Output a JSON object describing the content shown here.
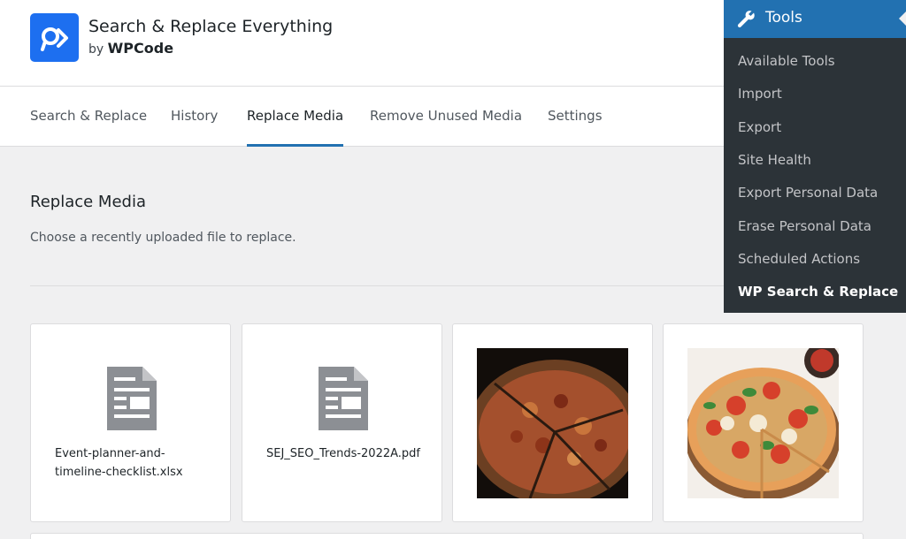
{
  "brand": {
    "title": "Search & Replace Everything",
    "by": "by",
    "by_brand": "WPCode",
    "accent": "#1d6ff0"
  },
  "tabs": [
    {
      "label": "Search & Replace",
      "active": false
    },
    {
      "label": "History",
      "active": false
    },
    {
      "label": "Replace Media",
      "active": true
    },
    {
      "label": "Remove Unused Media",
      "active": false
    },
    {
      "label": "Settings",
      "active": false
    }
  ],
  "section": {
    "title": "Replace Media",
    "description": "Choose a recently uploaded file to replace."
  },
  "media": [
    {
      "type": "document",
      "icon": "document-icon",
      "filename": "Event-planner-and-timeline-checklist.xlsx"
    },
    {
      "type": "document",
      "icon": "document-icon",
      "filename": "SEJ_SEO_Trends-2022A.pdf"
    },
    {
      "type": "image",
      "subject": "pizza-dark"
    },
    {
      "type": "image",
      "subject": "pizza-margherita"
    }
  ],
  "admin_menu": {
    "header": "Tools",
    "header_icon": "wrench-icon",
    "items": [
      {
        "label": "Available Tools",
        "current": false
      },
      {
        "label": "Import",
        "current": false
      },
      {
        "label": "Export",
        "current": false
      },
      {
        "label": "Site Health",
        "current": false
      },
      {
        "label": "Export Personal Data",
        "current": false
      },
      {
        "label": "Erase Personal Data",
        "current": false
      },
      {
        "label": "Scheduled Actions",
        "current": false
      },
      {
        "label": "WP Search & Replace",
        "current": true
      }
    ],
    "colors": {
      "background": "#2c3338",
      "header": "#2271b1"
    }
  }
}
